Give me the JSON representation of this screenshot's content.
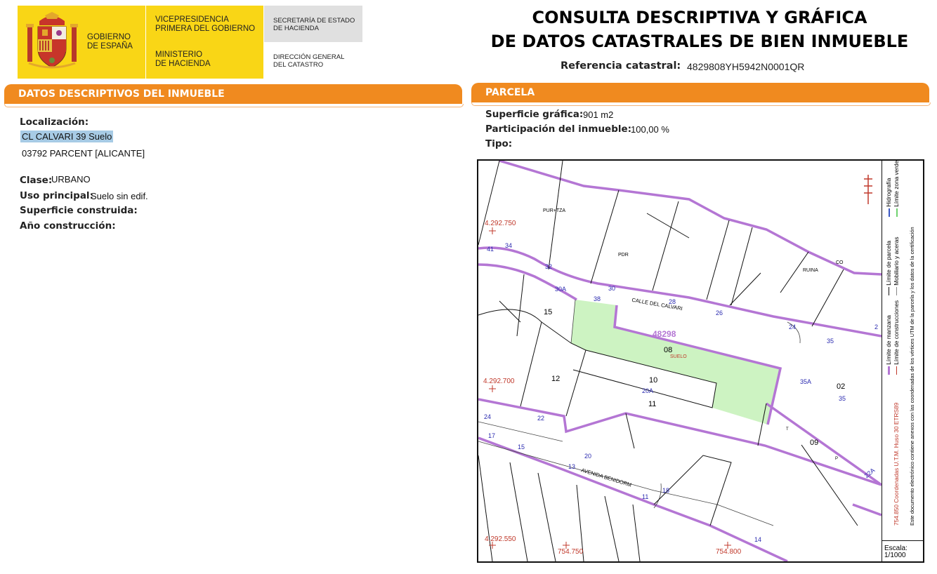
{
  "header": {
    "logo": {
      "gobierno": "GOBIERNO\nDE ESPAÑA",
      "vicepresidencia": "VICEPRESIDENCIA\nPRIMERA DEL GOBIERNO",
      "ministerio": "MINISTERIO\nDE HACIENDA",
      "secretaria": "SECRETARÍA DE ESTADO\nDE HACIENDA",
      "direccion": "DIRECCIÓN GENERAL\nDEL CATASTRO"
    },
    "title_line1": "CONSULTA DESCRIPTIVA Y GRÁFICA",
    "title_line2": "DE DATOS CATASTRALES DE BIEN INMUEBLE",
    "ref_label": "Referencia catastral:",
    "ref_value": "4829808YH5942N0001QR"
  },
  "descriptivos": {
    "section_title": "DATOS DESCRIPTIVOS DEL INMUEBLE",
    "localizacion_label": "Localización:",
    "address_line1": "CL CALVARI 39 Suelo",
    "address_line2": "03792 PARCENT [ALICANTE]",
    "clase_label": "Clase:",
    "clase_value": "URBANO",
    "uso_label": "Uso principal:",
    "uso_value": "Suelo sin edif.",
    "superficie_label": "Superficie construida:",
    "anio_label": "Año construcción:"
  },
  "parcela": {
    "section_title": "PARCELA",
    "superficie_label": "Superficie gráfica:",
    "superficie_value": "901 m2",
    "participacion_label": "Participación del inmueble:",
    "participacion_value": "100,00 %",
    "tipo_label": "Tipo:"
  },
  "map": {
    "coords": {
      "y_top": "4.292.750",
      "y_mid": "4.292.700",
      "y_bot": "4.292.550",
      "x_left": "754.750",
      "x_right": "754.800"
    },
    "labels": {
      "block": "48298",
      "parcel_08": "08",
      "suelo": "SUELO",
      "p15": "15",
      "p12": "12",
      "p10": "10",
      "p11": "11",
      "p02": "02",
      "p09": "09",
      "street1": "CALLE DEL CALVARI",
      "street2": "AVENIDA BENIDORM",
      "pdr": "PDR",
      "ruina": "RUINA",
      "co": "CO",
      "purtza": "PUR+TZA",
      "n41": "41",
      "n34": "34",
      "n32": "32",
      "n30": "30",
      "n30a": "30A",
      "n38": "38",
      "n28": "28",
      "n26": "26",
      "n24": "24",
      "n35": "35",
      "n2": "2",
      "n20a": "20A",
      "n35a": "35A",
      "n35b": "35",
      "n24b": "24",
      "n22": "22",
      "n17": "17",
      "n15": "15",
      "n20": "20",
      "n13": "13",
      "n18": "18",
      "n11": "11",
      "n14": "14",
      "n22a": "22A",
      "p": "P",
      "t": "T"
    },
    "legend": {
      "col1a": "Límite de manzana",
      "col1b": "Límite de construcciones",
      "col2a": "Límite de parcela",
      "col2b": "Mobiliario y aceras",
      "col3a": "Hidrografía",
      "col3b": "Límite zona verde",
      "utm": "754.850 Coordenadas U.T.M. Huso 30 ETRS89",
      "note": "Este documento electrónico contiene anexos con las coordenadas de los vértices UTM de la parcela y los datos de la certificación"
    },
    "escala_label": "Escala:",
    "escala_value": "1/1000"
  }
}
